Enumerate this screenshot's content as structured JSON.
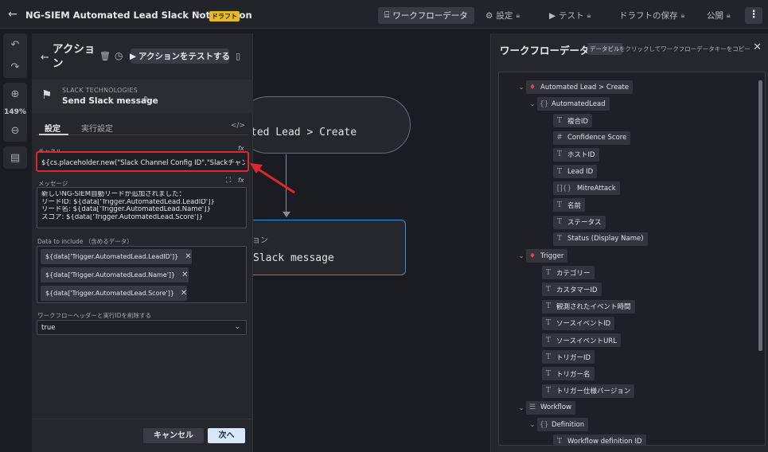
{
  "topbar": {
    "title": "NG-SIEM Automated Lead Slack Notification",
    "draft_badge": "ドラフト",
    "workflow_data_btn": "ワークフローデータ",
    "settings_btn": "設定",
    "test_btn": "テスト",
    "save_draft_btn": "ドラフトの保存",
    "publish_btn": "公開"
  },
  "zoom": {
    "level": "149%"
  },
  "canvas": {
    "node1_label": "ted Lead > Create",
    "node2_sub": "ョン",
    "node2_label": "Slack message"
  },
  "action_panel": {
    "title": "アクション",
    "test_action_btn": "アクションをテストする",
    "vendor": "SLACK TECHNOLOGIES",
    "action_name": "Send Slack message",
    "tabs": [
      "設定",
      "実行設定"
    ],
    "channel_label": "チャネル",
    "channel_value": "${cs.placeholder.new(\"Slack Channel Config ID\",\"Slackチャンネルの",
    "message_label": "メッセージ",
    "message_lines": [
      "新しいNG-SIEM自動リードが追加されました：",
      "リードID: ${data['Trigger.AutomatedLead.LeadID']}",
      "リード名: ${data['Trigger.AutomatedLead.Name']}",
      "スコア: ${data['Trigger.AutomatedLead.Score']}"
    ],
    "data_include_label": "Data to include （含めるデータ）",
    "chips": [
      "${data['Trigger.AutomatedLead.LeadID']}",
      "${data['Trigger.AutomatedLead.Name']}",
      "${data['Trigger.AutomatedLead.Score']}"
    ],
    "remove_header_label": "ワークフローヘッダーと実行IDを削除する",
    "remove_header_value": "true",
    "cancel_btn": "キャンセル",
    "next_btn": "次へ"
  },
  "workflow_panel": {
    "title": "ワークフローデータ",
    "pill": "データピル",
    "hint": "をクリックしてワークフローデータキーをコピー",
    "tree": [
      {
        "label": "Automated Lead > Create",
        "icon": "♦",
        "depth": 0,
        "caret": "⌄"
      },
      {
        "label": "AutomatedLead",
        "icon": "{}",
        "depth": 1,
        "caret": "⌄"
      },
      {
        "label": "複合ID",
        "icon": "T",
        "depth": 3
      },
      {
        "label": "Confidence Score",
        "icon": "#",
        "depth": 3
      },
      {
        "label": "ホストID",
        "icon": "T",
        "depth": 3
      },
      {
        "label": "Lead ID",
        "icon": "T",
        "depth": 3
      },
      {
        "label": "MitreAttack",
        "icon": "[]{}",
        "depth": 3
      },
      {
        "label": "名前",
        "icon": "T",
        "depth": 3
      },
      {
        "label": "ステータス",
        "icon": "T",
        "depth": 3
      },
      {
        "label": "Status (Display Name)",
        "icon": "T",
        "depth": 3
      },
      {
        "label": "Trigger",
        "icon": "♦",
        "depth": 0,
        "caret": "⌄"
      },
      {
        "label": "カテゴリー",
        "icon": "T",
        "depth": 2
      },
      {
        "label": "カスタマーID",
        "icon": "T",
        "depth": 2
      },
      {
        "label": "観測されたイベント時間",
        "icon": "T",
        "depth": 2
      },
      {
        "label": "ソースイベントID",
        "icon": "T",
        "depth": 2
      },
      {
        "label": "ソースイベントURL",
        "icon": "T",
        "depth": 2
      },
      {
        "label": "トリガーID",
        "icon": "T",
        "depth": 2
      },
      {
        "label": "トリガー名",
        "icon": "T",
        "depth": 2
      },
      {
        "label": "トリガー仕様バージョン",
        "icon": "T",
        "depth": 2
      },
      {
        "label": "Workflow",
        "icon": "☰",
        "depth": 0,
        "caret": "⌄"
      },
      {
        "label": "Definition",
        "icon": "{}",
        "depth": 1,
        "caret": "⌄"
      },
      {
        "label": "Workflow definition ID",
        "icon": "T",
        "depth": 3
      }
    ]
  },
  "colors": {
    "accent": "#3a8fd9",
    "highlight": "#e0262d",
    "draft": "#e9b825"
  }
}
